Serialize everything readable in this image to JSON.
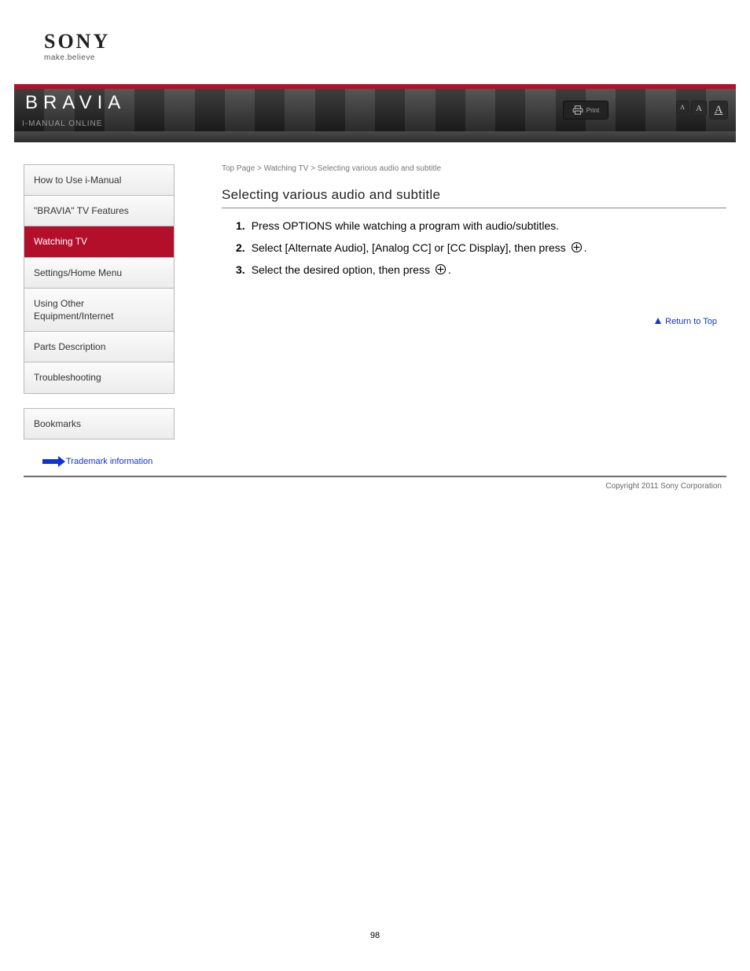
{
  "logo": {
    "brand": "SONY",
    "tagline": "make.believe"
  },
  "banner": {
    "brand": "BRAVIA",
    "guide": "i-Manual online",
    "print_label": "Print",
    "font_size_glyph": "A"
  },
  "sidebar": {
    "main_menu": [
      {
        "label": "How to Use i-Manual",
        "active": false
      },
      {
        "label": "\"BRAVIA\" TV Features",
        "active": false
      },
      {
        "label": "Watching TV",
        "active": true
      },
      {
        "label": "Settings/Home Menu",
        "active": false
      },
      {
        "label": "Using Other Equipment/Internet",
        "active": false
      },
      {
        "label": "Parts Description",
        "active": false
      },
      {
        "label": "Troubleshooting",
        "active": false
      }
    ],
    "sub_menu": [
      {
        "label": "Bookmarks"
      }
    ],
    "trademark": "Trademark information"
  },
  "main": {
    "breadcrumb": "Top Page > Watching TV > Selecting various audio and subtitle",
    "title": "Selecting various audio and subtitle",
    "steps": [
      {
        "n": "1.",
        "text_pre": "Press OPTIONS while watching a program with audio/subtitles."
      },
      {
        "n": "2.",
        "text_pre": "Select [Alternate Audio], [Analog CC] or [CC Display], then press ",
        "icon": "plus-circle",
        "text_post": "."
      },
      {
        "n": "3.",
        "text_pre": "Select the desired option, then press ",
        "icon": "plus-circle",
        "text_post": "."
      }
    ],
    "top_link": "Return to Top"
  },
  "footer": {
    "copyright": "Copyright 2011 Sony Corporation"
  },
  "page_number": "98"
}
